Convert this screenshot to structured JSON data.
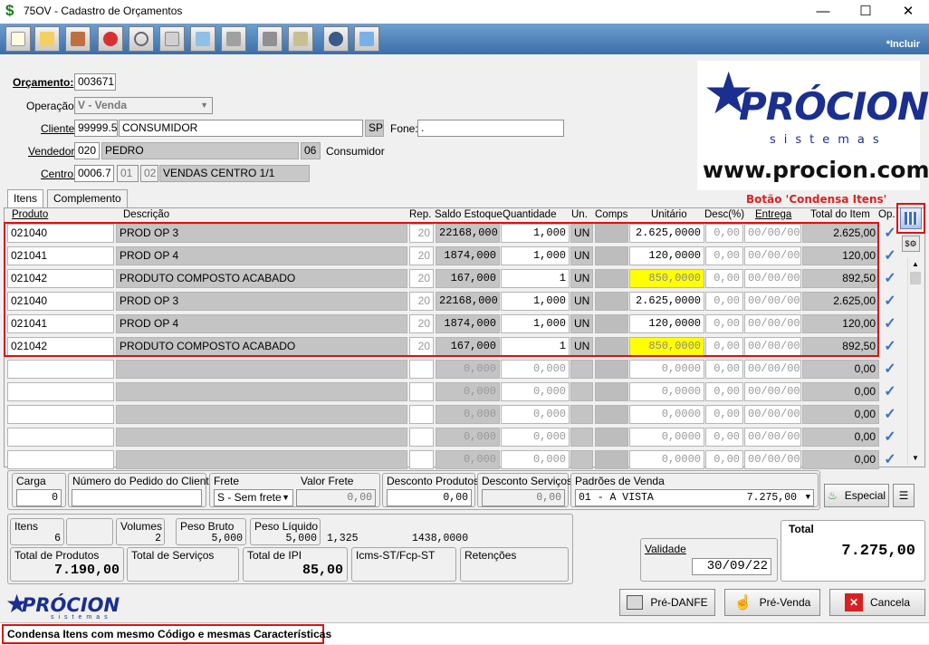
{
  "window": {
    "title": "75OV - Cadastro de Orçamentos",
    "mode": "*Incluir"
  },
  "form": {
    "orcamento_label": "Orçamento:",
    "orcamento": "003671",
    "operacao_label": "Operação:",
    "operacao": "V - Venda",
    "cliente_label": "Cliente:",
    "cliente_codigo": "99999.5",
    "cliente_nome": "CONSUMIDOR",
    "uf": "SP",
    "fone_label": "Fone:",
    "fone": ".",
    "vendedor_label": "Vendedor:",
    "vendedor_codigo": "020",
    "vendedor_nome": "PEDRO",
    "vendedor_ext": "06",
    "vendedor_tipo": "Consumidor",
    "centro_label": "Centro:",
    "centro_codigo": "0006.7",
    "centro_a": "01",
    "centro_b": "02",
    "centro_nome": "VENDAS CENTRO 1/1"
  },
  "logo": {
    "brand": "PRÓCION",
    "sub": "sistemas",
    "url": "www.procion.com",
    "small_brand": "PRÓCION",
    "small_sub": "sistemas"
  },
  "note": "Botão 'Condensa Itens'",
  "tabs": [
    "Itens",
    "Complemento"
  ],
  "grid": {
    "headers": [
      "Produto",
      "Descrição",
      "Rep.",
      "Saldo Estoque",
      "Quantidade",
      "Un.",
      "Comps",
      "Unitário",
      "Desc(%)",
      "Entrega",
      "Total do Item",
      "Op."
    ],
    "rows": [
      {
        "produto": "021040",
        "descricao": "PROD OP 3",
        "rep": "20",
        "saldo": "22168,000",
        "qtd": "1,000",
        "un": "UN",
        "unit": "2.625,0000",
        "desc": "0,00",
        "entrega": "00/00/00",
        "total": "2.625,00",
        "hl": false
      },
      {
        "produto": "021041",
        "descricao": "PROD OP 4",
        "rep": "20",
        "saldo": "1874,000",
        "qtd": "1,000",
        "un": "UN",
        "unit": "120,0000",
        "desc": "0,00",
        "entrega": "00/00/00",
        "total": "120,00",
        "hl": false
      },
      {
        "produto": "021042",
        "descricao": "PRODUTO COMPOSTO ACABADO",
        "rep": "20",
        "saldo": "167,000",
        "qtd": "1",
        "un": "UN",
        "unit": "850,0000",
        "desc": "0,00",
        "entrega": "00/00/00",
        "total": "892,50",
        "hl": true
      },
      {
        "produto": "021040",
        "descricao": "PROD OP 3",
        "rep": "20",
        "saldo": "22168,000",
        "qtd": "1,000",
        "un": "UN",
        "unit": "2.625,0000",
        "desc": "0,00",
        "entrega": "00/00/00",
        "total": "2.625,00",
        "hl": false
      },
      {
        "produto": "021041",
        "descricao": "PROD OP 4",
        "rep": "20",
        "saldo": "1874,000",
        "qtd": "1,000",
        "un": "UN",
        "unit": "120,0000",
        "desc": "0,00",
        "entrega": "00/00/00",
        "total": "120,00",
        "hl": false
      },
      {
        "produto": "021042",
        "descricao": "PRODUTO COMPOSTO ACABADO",
        "rep": "20",
        "saldo": "167,000",
        "qtd": "1",
        "un": "UN",
        "unit": "850,0000",
        "desc": "0,00",
        "entrega": "00/00/00",
        "total": "892,50",
        "hl": true
      }
    ],
    "empty": {
      "saldo": "0,000",
      "qtd": "0,000",
      "unit": "0,0000",
      "desc": "0,00",
      "entrega": "00/00/00",
      "total": "0,00"
    }
  },
  "footer": {
    "carga_label": "Carga",
    "carga": "0",
    "pedido_label": "Número do Pedido do Cliente",
    "frete_label": "Frete",
    "frete": "S - Sem frete",
    "valor_frete_label": "Valor Frete",
    "valor_frete": "0,00",
    "desc_prod_label": "Desconto Produtos",
    "desc_prod": "0,00",
    "desc_serv_label": "Desconto Serviços",
    "desc_serv": "0,00",
    "padroes_label": "Padrões de Venda",
    "padrao": "01 - A VISTA",
    "padrao_valor": "7.275,00",
    "especial": "Especial",
    "itens_label": "Itens",
    "itens": "6",
    "volumes_label": "Volumes",
    "volumes": "2",
    "peso_bruto_label": "Peso Bruto",
    "peso_bruto": "5,000",
    "peso_liq_label": "Peso Líquido",
    "peso_liq": "5,000",
    "extra1": "1,325",
    "extra2": "1438,0000",
    "total_prod_label": "Total de Produtos",
    "total_prod": "7.190,00",
    "total_serv_label": "Total de Serviços",
    "total_ipi_label": "Total de IPI",
    "total_ipi": "85,00",
    "icms_label": "Icms-ST/Fcp-ST",
    "retencoes_label": "Retenções",
    "validade_label": "Validade",
    "validade": "30/09/22",
    "total_label": "Total",
    "total": "7.275,00"
  },
  "buttons": {
    "pre_danfe": "Pré-DANFE",
    "pre_venda": "Pré-Venda",
    "cancela": "Cancela"
  },
  "status": "Condensa Itens com mesmo Código e mesmas Características",
  "colors": {
    "toolbar": "#4a7fbf",
    "highlight": "#ffff00",
    "annotation": "#e01010"
  }
}
